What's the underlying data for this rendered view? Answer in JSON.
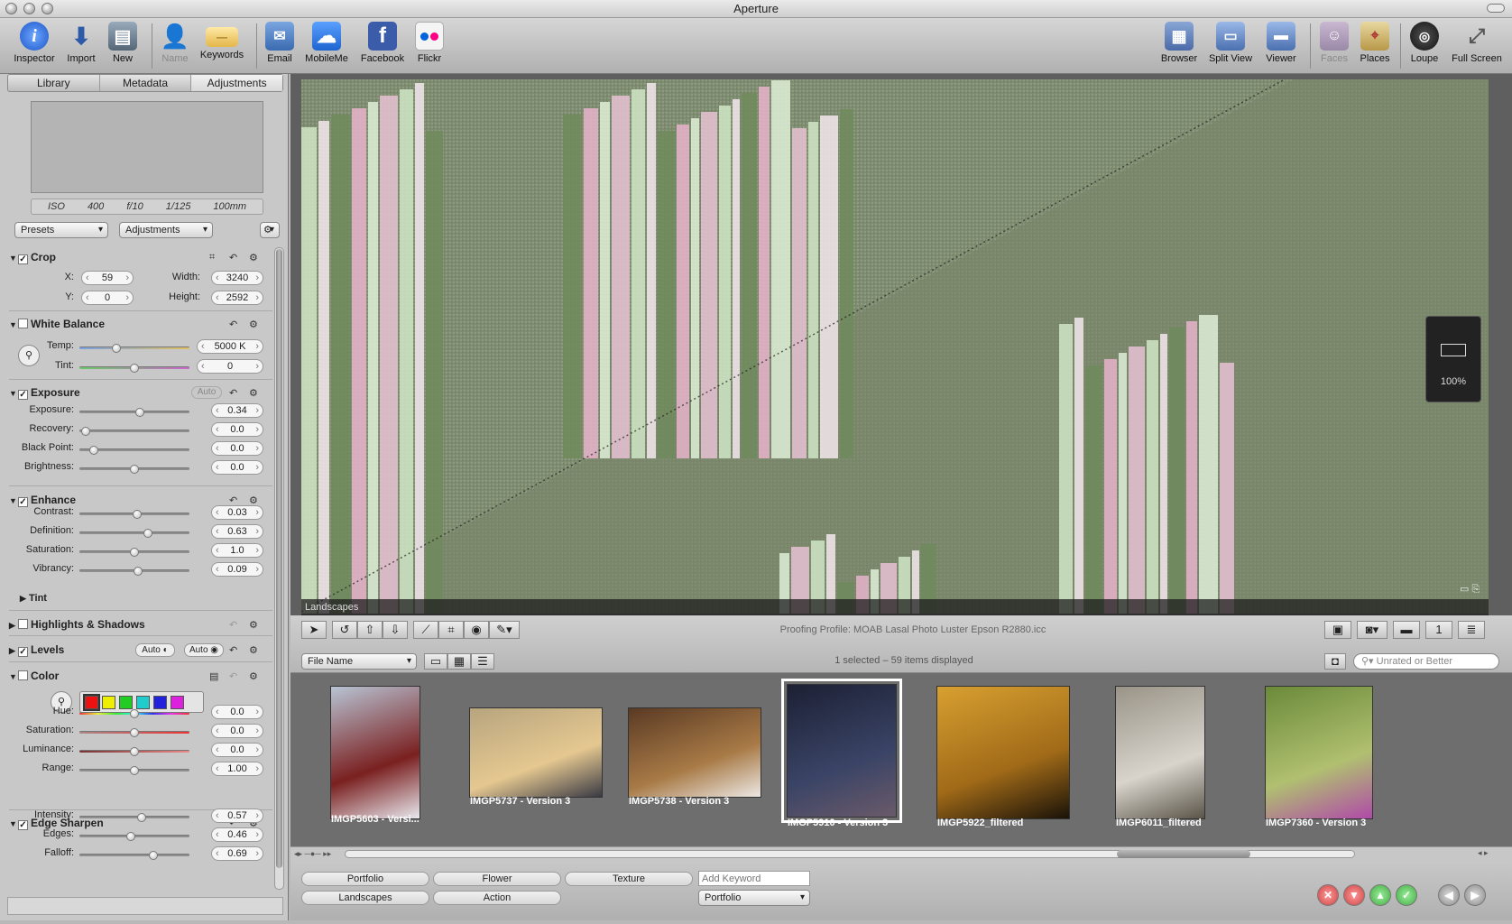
{
  "window": {
    "title": "Aperture"
  },
  "toolbar": {
    "left": [
      "Inspector",
      "Import",
      "New",
      "Name",
      "Keywords",
      "Email",
      "MobileMe",
      "Facebook",
      "Flickr"
    ],
    "right": [
      "Browser",
      "Split View",
      "Viewer",
      "Faces",
      "Places",
      "Loupe",
      "Full Screen"
    ]
  },
  "tabs": [
    "Library",
    "Metadata",
    "Adjustments"
  ],
  "exif": {
    "iso": "ISO 400",
    "aperture": "f/10",
    "shutter": "1/125",
    "focal": "100mm"
  },
  "presets": {
    "presets_label": "Presets",
    "adjustments_label": "Adjustments"
  },
  "crop": {
    "title": "Crop",
    "x_label": "X:",
    "x": "59",
    "y_label": "Y:",
    "y": "0",
    "width_label": "Width:",
    "width": "3240",
    "height_label": "Height:",
    "height": "2592"
  },
  "white_balance": {
    "title": "White Balance",
    "temp_label": "Temp:",
    "temp": "5000 K",
    "tint_label": "Tint:",
    "tint": "0"
  },
  "exposure": {
    "title": "Exposure",
    "auto": "Auto",
    "rows": [
      {
        "label": "Exposure:",
        "value": "0.34",
        "pos": 0.55
      },
      {
        "label": "Recovery:",
        "value": "0.0",
        "pos": 0.02
      },
      {
        "label": "Black Point:",
        "value": "0.0",
        "pos": 0.1
      },
      {
        "label": "Brightness:",
        "value": "0.0",
        "pos": 0.5
      }
    ]
  },
  "enhance": {
    "title": "Enhance",
    "tint": "Tint",
    "rows": [
      {
        "label": "Contrast:",
        "value": "0.03",
        "pos": 0.53
      },
      {
        "label": "Definition:",
        "value": "0.63",
        "pos": 0.63
      },
      {
        "label": "Saturation:",
        "value": "1.0",
        "pos": 0.5
      },
      {
        "label": "Vibrancy:",
        "value": "0.09",
        "pos": 0.54
      }
    ]
  },
  "highlights": {
    "title": "Highlights & Shadows"
  },
  "levels": {
    "title": "Levels",
    "auto1": "Auto",
    "auto2": "Auto"
  },
  "color": {
    "title": "Color",
    "swatches": [
      "#e11",
      "#ee0",
      "#2c2",
      "#2cc",
      "#22d",
      "#d2d"
    ],
    "rows": [
      {
        "label": "Hue:",
        "value": "0.0",
        "pos": 0.5
      },
      {
        "label": "Saturation:",
        "value": "0.0",
        "pos": 0.5
      },
      {
        "label": "Luminance:",
        "value": "0.0",
        "pos": 0.5
      },
      {
        "label": "Range:",
        "value": "1.00",
        "pos": 0.5
      }
    ]
  },
  "edge": {
    "title": "Edge Sharpen",
    "rows": [
      {
        "label": "Intensity:",
        "value": "0.57",
        "pos": 0.57
      },
      {
        "label": "Edges:",
        "value": "0.46",
        "pos": 0.46
      },
      {
        "label": "Falloff:",
        "value": "0.69",
        "pos": 0.69
      }
    ]
  },
  "viewer": {
    "project": "Landscapes",
    "zoom": "100%"
  },
  "controls": {
    "proofing": "Proofing Profile: MOAB Lasal Photo Luster Epson R2880.icc",
    "sort": "File Name",
    "status": "1 selected – 59 items displayed",
    "filter_placeholder": "Unrated or Better"
  },
  "thumbs": [
    {
      "name": "IMGP5603 - Versi...",
      "colors": [
        "#b8c4d4",
        "#7a2020",
        "#e8e8ee"
      ]
    },
    {
      "name": "IMGP5737 - Version 3",
      "colors": [
        "#b7a47e",
        "#e5c890",
        "#3a3a44"
      ]
    },
    {
      "name": "IMGP5738 - Version 3",
      "colors": [
        "#5a3a24",
        "#a87a46",
        "#ece8e4"
      ]
    },
    {
      "name": "IMGP5910 - Version 3",
      "colors": [
        "#1c2034",
        "#3a4466",
        "#6a5a6a"
      ]
    },
    {
      "name": "IMGP5922_filtered",
      "colors": [
        "#d8a030",
        "#a06a18",
        "#1a1208"
      ]
    },
    {
      "name": "IMGP6011_filtered",
      "colors": [
        "#9a9488",
        "#d8d4cc",
        "#5a5448"
      ]
    },
    {
      "name": "IMGP7360 - Version 3",
      "colors": [
        "#6a8a3a",
        "#b0c070",
        "#b04aa8"
      ]
    }
  ],
  "keywords": {
    "buttons": [
      "Portfolio",
      "Flower",
      "Texture",
      "Landscapes",
      "Action"
    ],
    "add_placeholder": "Add Keyword",
    "preset": "Portfolio"
  }
}
